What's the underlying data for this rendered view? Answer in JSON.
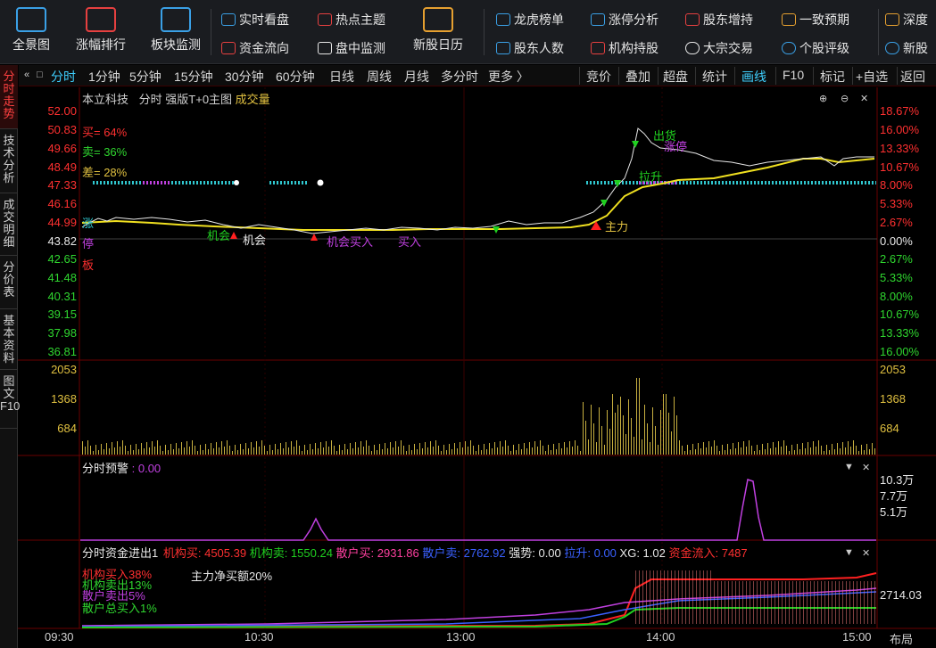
{
  "toolbar": {
    "big": [
      {
        "label": "全景图",
        "icon": "panorama-icon",
        "color": "#3aa0e6"
      },
      {
        "label": "涨幅排行",
        "icon": "ranking-chart-icon",
        "color": "#e64040"
      },
      {
        "label": "板块监测",
        "icon": "sector-monitor-icon",
        "color": "#3aa0e6"
      },
      {
        "label": "新股日历",
        "icon": "calendar-icon",
        "color": "#e6a030"
      }
    ],
    "small_col1": [
      "实时看盘",
      "资金流向"
    ],
    "small_col2": [
      "热点主题",
      "盘中监测"
    ],
    "small_col3": [
      "龙虎榜单",
      "股东人数"
    ],
    "small_col4": [
      "涨停分析",
      "机构持股"
    ],
    "small_col5": [
      "股东增持",
      "大宗交易"
    ],
    "small_col6": [
      "一致预期",
      "个股评级"
    ],
    "small_col7": [
      "深度",
      "新股"
    ]
  },
  "vtabs": [
    {
      "label": "分时走势",
      "active": true
    },
    {
      "label": "技术分析",
      "active": false
    },
    {
      "label": "成交明细",
      "active": false
    },
    {
      "label": "分价表",
      "active": false
    },
    {
      "label": "基本资料",
      "active": false
    },
    {
      "label": "图文F10",
      "active": false
    }
  ],
  "period_tabs": {
    "items": [
      "分时",
      "1分钟",
      "5分钟",
      "15分钟",
      "30分钟",
      "60分钟",
      "日线",
      "周线",
      "月线",
      "多分时",
      "更多 〉"
    ],
    "active": "分时"
  },
  "right_tabs": {
    "items": [
      "竞价",
      "叠加",
      "超盘",
      "统计",
      "画线",
      "F10",
      "标记",
      "+自选",
      "返回"
    ],
    "active": "画线"
  },
  "chart": {
    "stock_name": "本立科技",
    "mode": "分时",
    "indicator": "强版T+0主图",
    "volume_label": "成交量",
    "price_left": [
      "52.00",
      "50.83",
      "49.66",
      "48.49",
      "47.33",
      "46.16",
      "44.99",
      "43.82",
      "42.65",
      "41.48",
      "40.31",
      "39.15",
      "37.98",
      "36.81"
    ],
    "pct_right": [
      "18.67%",
      "16.00%",
      "13.33%",
      "10.67%",
      "8.00%",
      "5.33%",
      "2.67%",
      "0.00%",
      "2.67%",
      "5.33%",
      "8.00%",
      "10.67%",
      "13.33%",
      "16.00%"
    ],
    "buy_ratio": "买= 64%",
    "sell_ratio": "卖= 36%",
    "diff_ratio": "差= 28%",
    "side_marks": [
      "涨",
      "停",
      "板"
    ],
    "annotations": [
      "出货",
      "涨停",
      "拉升",
      "主力",
      "机会",
      "机会",
      "机会买入",
      "买入"
    ],
    "volume_left": [
      "2053",
      "1368",
      "684"
    ],
    "volume_right": [
      "2053",
      "1368",
      "684"
    ]
  },
  "alert_panel": {
    "title": "分时预警",
    "value": ": 0.00",
    "right_axis": [
      "10.3万",
      "7.7万",
      "5.1万"
    ]
  },
  "fund_panel": {
    "title": "分时资金进出1",
    "inst_buy": "机构买: 4505.39",
    "inst_sell": "机构卖: 1550.24",
    "retail_buy": "散户买: 2931.86",
    "retail_sell": "散户卖: 2762.92",
    "strength": "强势: 0.00",
    "pull_up": "拉升: 0.00",
    "xg": "XG: 1.02",
    "fund_in": "资金流入: 7487",
    "lines": [
      "机构买入38%",
      "机构卖出13%",
      "散户卖出5%",
      "散户总买入1%"
    ],
    "main_net": "主力净买额20%",
    "right_value": "2714.03"
  },
  "time_axis": [
    "09:30",
    "10:30",
    "13:00",
    "14:00",
    "15:00"
  ],
  "layout_btn": "布局"
}
